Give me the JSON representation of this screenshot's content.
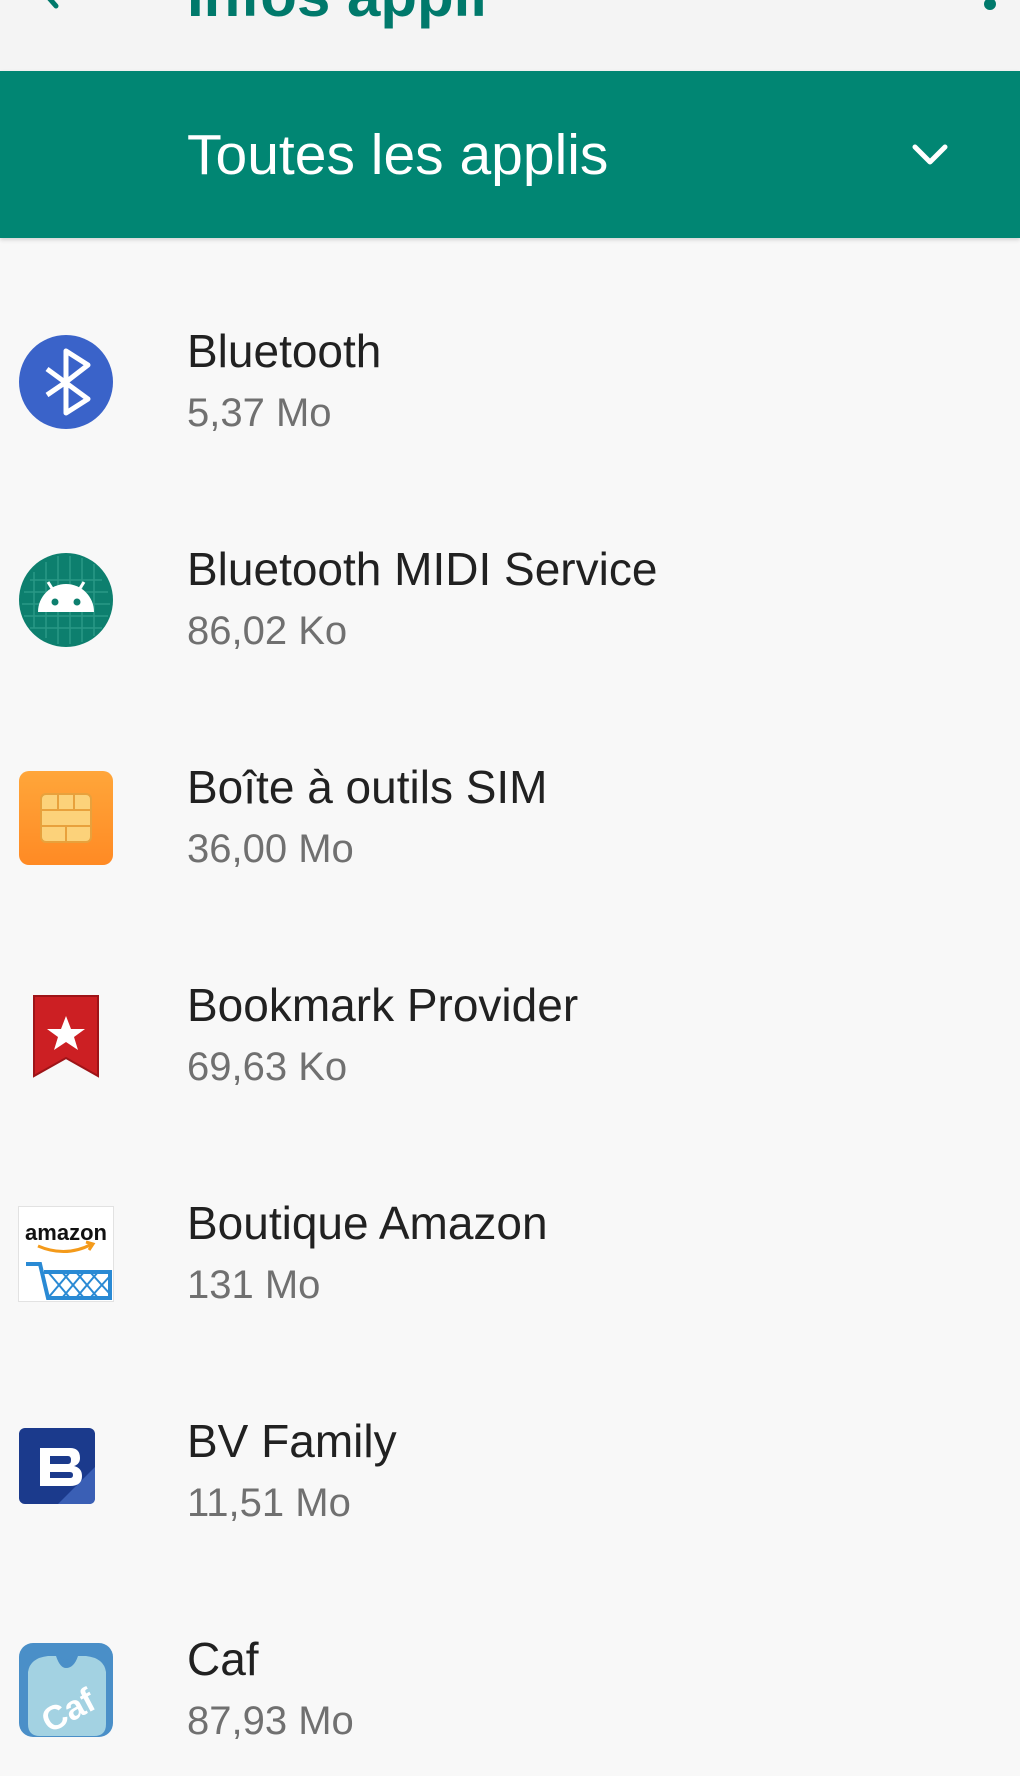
{
  "header": {
    "title": "Infos appli",
    "back_icon": "arrow-back-icon",
    "more_icon": "more-vert-icon",
    "accent_color": "#00796b"
  },
  "filter": {
    "label": "Toutes les applis",
    "chevron_icon": "chevron-down-icon",
    "background_color": "#018673"
  },
  "apps": [
    {
      "name": "Bluetooth",
      "size": "5,37 Mo",
      "icon": "bluetooth-icon"
    },
    {
      "name": "Bluetooth MIDI Service",
      "size": "86,02 Ko",
      "icon": "android-icon"
    },
    {
      "name": "Boîte à outils SIM",
      "size": "36,00 Mo",
      "icon": "sim-card-icon"
    },
    {
      "name": "Bookmark Provider",
      "size": "69,63 Ko",
      "icon": "bookmark-icon"
    },
    {
      "name": "Boutique Amazon",
      "size": "131 Mo",
      "icon": "amazon-icon",
      "icon_text": "amazon"
    },
    {
      "name": "BV Family",
      "size": "11,51 Mo",
      "icon": "bv-family-icon"
    },
    {
      "name": "Caf",
      "size": "87,93 Mo",
      "icon": "caf-icon",
      "icon_text": "Caf"
    }
  ]
}
